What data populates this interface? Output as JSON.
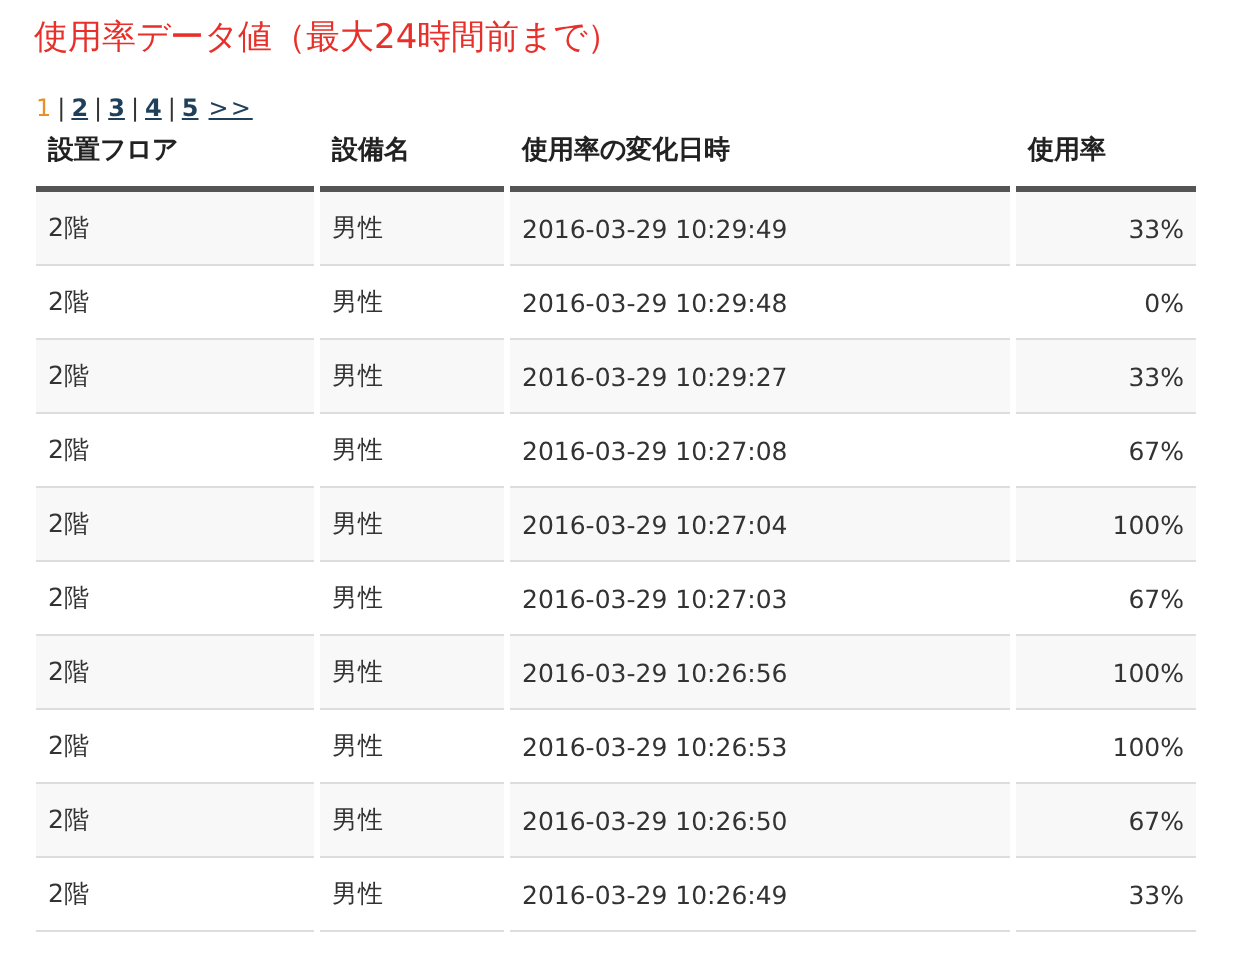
{
  "title": "使用率データ値（最大24時間前まで）",
  "pagination": [
    {
      "kind": "page",
      "label": "1",
      "selected": true
    },
    {
      "kind": "sep",
      "label": "|"
    },
    {
      "kind": "page",
      "label": "2",
      "selected": false
    },
    {
      "kind": "sep",
      "label": "|"
    },
    {
      "kind": "page",
      "label": "3",
      "selected": false
    },
    {
      "kind": "sep",
      "label": "|"
    },
    {
      "kind": "page",
      "label": "4",
      "selected": false
    },
    {
      "kind": "sep",
      "label": "|"
    },
    {
      "kind": "page",
      "label": "5",
      "selected": false
    },
    {
      "kind": "next",
      "label": ">>"
    }
  ],
  "table": {
    "columns": [
      "設置フロア",
      "設備名",
      "使用率の変化日時",
      "使用率"
    ],
    "rows": [
      [
        "2階",
        "男性",
        "2016-03-29 10:29:49",
        "33%"
      ],
      [
        "2階",
        "男性",
        "2016-03-29 10:29:48",
        "0%"
      ],
      [
        "2階",
        "男性",
        "2016-03-29 10:29:27",
        "33%"
      ],
      [
        "2階",
        "男性",
        "2016-03-29 10:27:08",
        "67%"
      ],
      [
        "2階",
        "男性",
        "2016-03-29 10:27:04",
        "100%"
      ],
      [
        "2階",
        "男性",
        "2016-03-29 10:27:03",
        "67%"
      ],
      [
        "2階",
        "男性",
        "2016-03-29 10:26:56",
        "100%"
      ],
      [
        "2階",
        "男性",
        "2016-03-29 10:26:53",
        "100%"
      ],
      [
        "2階",
        "男性",
        "2016-03-29 10:26:50",
        "67%"
      ],
      [
        "2階",
        "男性",
        "2016-03-29 10:26:49",
        "33%"
      ]
    ]
  }
}
